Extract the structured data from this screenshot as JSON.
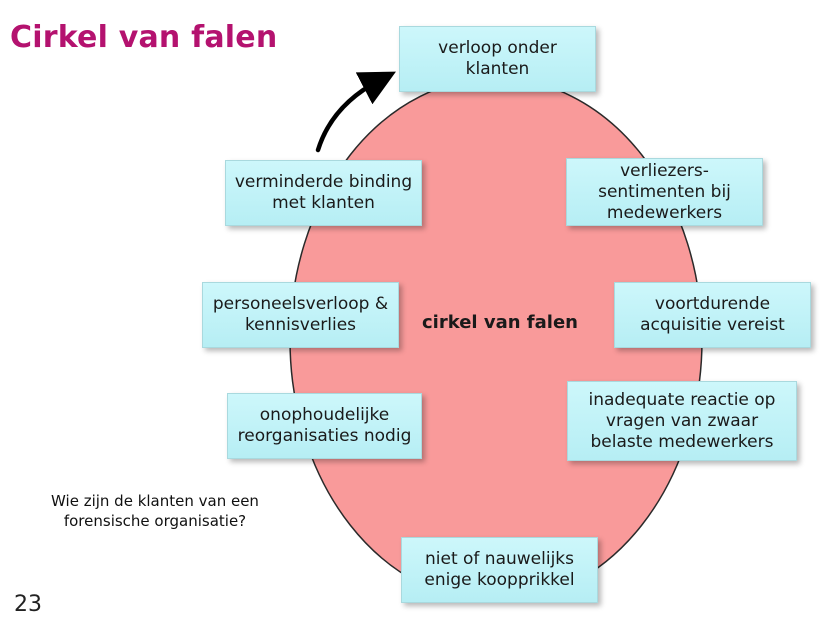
{
  "title": "Cirkel van falen",
  "center_label": "cirkel van falen",
  "question": "Wie zijn de klanten van een\nforensische organisatie?",
  "page_number": "23",
  "colors": {
    "title": "#b4126f",
    "ellipse": "#f99a9a",
    "box": "#c4f3f8"
  },
  "boxes": {
    "top": "verloop onder\nklanten",
    "upper_left": "verminderde binding\nmet klanten",
    "upper_right": "verliezers-\nsentimenten bij\nmedewerkers",
    "mid_left": "personeelsverloop &\nkennisverlies",
    "mid_right": "voortdurende\nacquisitie vereist",
    "lower_left": "onophoudelijke\nreorganisaties nodig",
    "lower_right": "inadequate reactie op\nvragen van zwaar\nbelaste medewerkers",
    "bottom": "niet of nauwelijks\nenige koopprikkel"
  }
}
